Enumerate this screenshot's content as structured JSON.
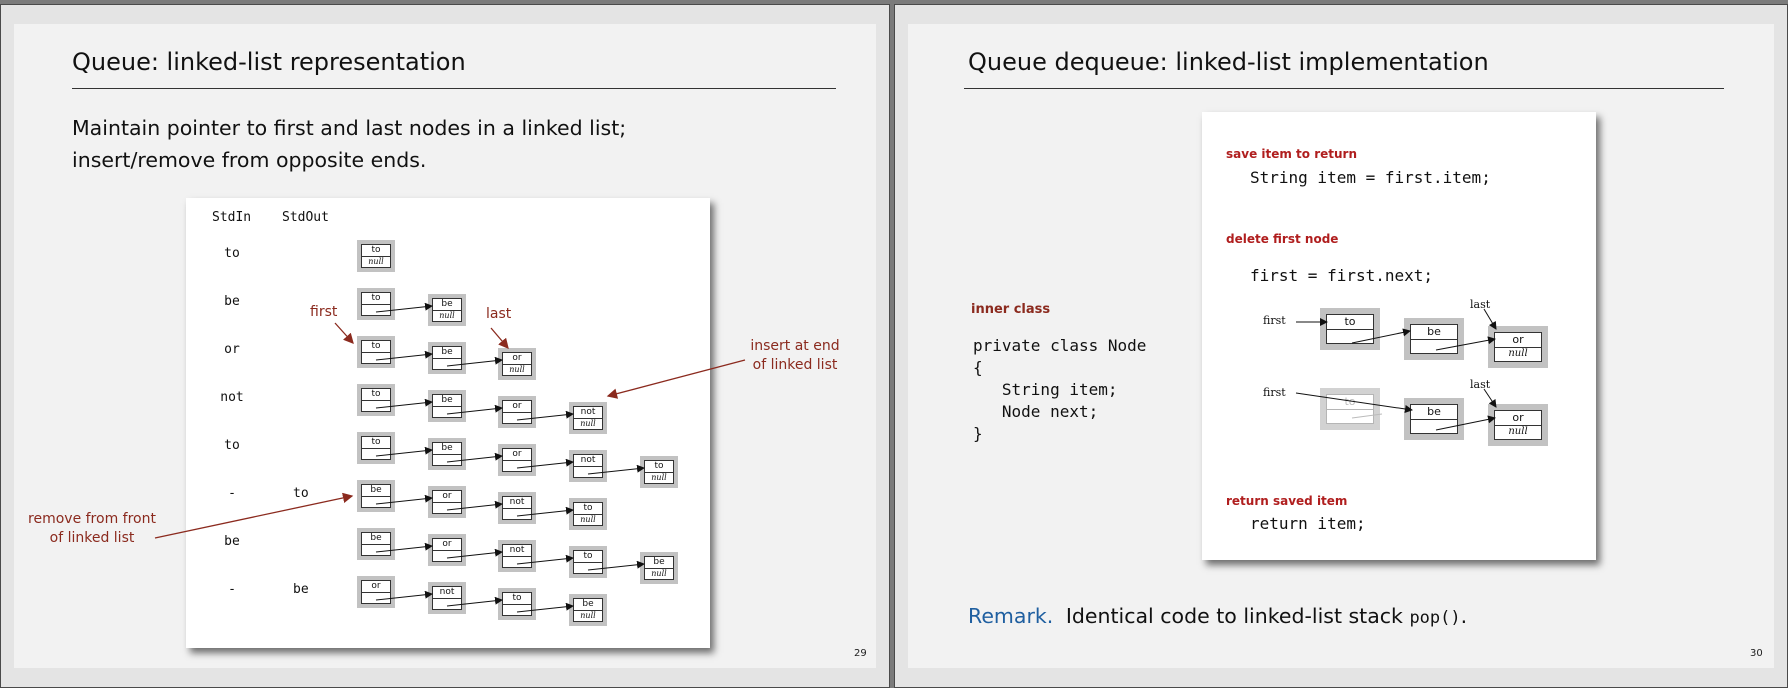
{
  "slide1": {
    "title": "Queue:  linked-list representation",
    "body_line1": "Maintain pointer to first and last nodes in a linked list;",
    "body_line2": "insert/remove from opposite ends.",
    "page_number": "29",
    "header_stdin": "StdIn",
    "header_stdout": "StdOut",
    "label_first": "first",
    "label_last": "last",
    "label_insert_line1": "insert at end",
    "label_insert_line2": "of linked list",
    "label_remove_line1": "remove from front",
    "label_remove_line2": "of linked list",
    "null_text": "null",
    "rows": [
      {
        "stdin": "to",
        "stdout": "",
        "nodes": [
          "to"
        ]
      },
      {
        "stdin": "be",
        "stdout": "",
        "nodes": [
          "to",
          "be"
        ]
      },
      {
        "stdin": "or",
        "stdout": "",
        "nodes": [
          "to",
          "be",
          "or"
        ]
      },
      {
        "stdin": "not",
        "stdout": "",
        "nodes": [
          "to",
          "be",
          "or",
          "not"
        ]
      },
      {
        "stdin": "to",
        "stdout": "",
        "nodes": [
          "to",
          "be",
          "or",
          "not",
          "to"
        ]
      },
      {
        "stdin": "-",
        "stdout": "to",
        "nodes": [
          "be",
          "or",
          "not",
          "to"
        ]
      },
      {
        "stdin": "be",
        "stdout": "",
        "nodes": [
          "be",
          "or",
          "not",
          "to",
          "be"
        ]
      },
      {
        "stdin": "-",
        "stdout": "be",
        "nodes": [
          "or",
          "not",
          "to",
          "be"
        ]
      }
    ]
  },
  "slide2": {
    "title": "Queue dequeue:  linked-list implementation",
    "page_number": "30",
    "inner_class_label": "inner class",
    "code_lines": [
      "private class Node",
      "{",
      "   String item;",
      "   Node next;",
      "}"
    ],
    "section_save": "save item to return",
    "code_save": "String item = first.item;",
    "section_delete": "delete first node",
    "code_delete": "first = first.next;",
    "section_return": "return saved item",
    "code_return": "return item;",
    "diagram_first": "first",
    "diagram_last": "last",
    "diagram_nodes": [
      "to",
      "be",
      "or"
    ],
    "null_text": "null",
    "remark_label": "Remark.",
    "remark_text": "Identical code to linked-list stack ",
    "remark_code": "pop()",
    "remark_end": "."
  },
  "colors": {
    "annotation": "#8b2a1e",
    "section_heading": "#b01e1e",
    "remark": "#1f5fa0"
  }
}
